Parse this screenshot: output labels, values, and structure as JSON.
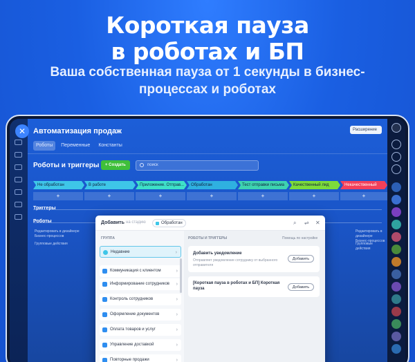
{
  "promo": {
    "headline_line1": "Короткая пауза",
    "headline_line2": "в роботах и БП",
    "subline_line1": "Ваша собственная пауза от 1 секунды в бизнес-",
    "subline_line2": "процессах и роботах"
  },
  "app": {
    "title": "Автоматизация продаж",
    "extensions_label": "Расширение",
    "tabs": [
      {
        "label": "Роботы",
        "active": true
      },
      {
        "label": "Переменные",
        "active": false
      },
      {
        "label": "Константы",
        "active": false
      }
    ],
    "section_title": "Роботы и триггеры",
    "create_label": "+ Создать",
    "search_placeholder": "поиск",
    "stages": [
      {
        "label": "Не обработан",
        "color": "#3ec6e8"
      },
      {
        "label": "В работе",
        "color": "#3ec6e8"
      },
      {
        "label": "Приложение. Отправ...",
        "color": "#3ee0c8"
      },
      {
        "label": "Обработан",
        "color": "#2fb0e0"
      },
      {
        "label": "Тест отправки письма",
        "color": "#3ed3b0"
      },
      {
        "label": "Качественный лид",
        "color": "#7ddc3a"
      },
      {
        "label": "Некачественный",
        "color": "#f2405a"
      }
    ],
    "plus": "+",
    "triggers_label": "Триггеры",
    "robots_label": "Роботы",
    "ghost_left_1": "Редактировать в дизайнере",
    "ghost_left_2": "Бизнес-процессов",
    "ghost_left_3": "Групповые действия",
    "ghost_right_1": "Редактировать в дизайнере",
    "ghost_right_2": "Бизнес-процессов",
    "ghost_right_3": "Групповые действия"
  },
  "popup": {
    "title": "Добавить",
    "in_label": "на стадию",
    "stage": "Обработан",
    "left_header": "ГРУППА",
    "right_header": "РОБОТЫ И ТРИГГЕРЫ",
    "help": "Помощь по настройке",
    "groups": [
      {
        "label": "Недавние",
        "color": "#3ec6e8",
        "highlight": true
      },
      {
        "label": "Коммуникация с клиентом",
        "color": "#2f8ef0"
      },
      {
        "label": "Информирование сотрудников",
        "color": "#2f8ef0"
      },
      {
        "label": "Контроль сотрудников",
        "color": "#2f8ef0"
      },
      {
        "label": "Оформление документов",
        "color": "#2f8ef0"
      },
      {
        "label": "Оплата товаров и услуг",
        "color": "#2f8ef0"
      },
      {
        "label": "Управление доставкой",
        "color": "#2f8ef0"
      },
      {
        "label": "Повторные продажи",
        "color": "#2f8ef0"
      }
    ],
    "cards": [
      {
        "title": "Добавить уведомление",
        "desc1": "Отправляет уведомление сотруднику от выбранного",
        "desc2": "отправителя",
        "button": "Добавить"
      },
      {
        "title": "[Короткая пауза в роботах и БП] Короткая",
        "title2": "пауза",
        "button": "Добавить"
      }
    ]
  }
}
